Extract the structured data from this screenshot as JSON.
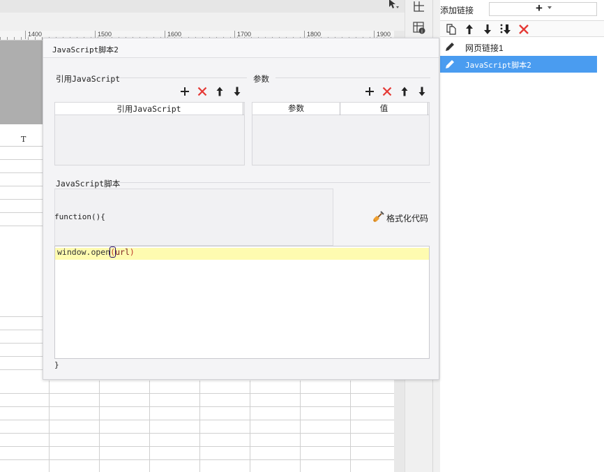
{
  "ruler": {
    "labels": [
      "1400",
      "1500",
      "1600",
      "1700",
      "1800",
      "1900"
    ]
  },
  "sheet": {
    "column_header": "T"
  },
  "link_panel": {
    "add_link_label": "添加链接",
    "add_link_button": "+",
    "toolbar": [
      {
        "name": "copy-icon"
      },
      {
        "name": "move-up-icon"
      },
      {
        "name": "move-down-icon"
      },
      {
        "name": "move-bottom-icon"
      },
      {
        "name": "delete-icon"
      }
    ],
    "items": [
      {
        "label": "网页链接1",
        "selected": false
      },
      {
        "label": "JavaScript脚本2",
        "selected": true
      }
    ]
  },
  "dialog": {
    "title": "JavaScript脚本2",
    "ref_section": {
      "label": "引用JavaScript",
      "table_header": "引用JavaScript"
    },
    "param_section": {
      "label": "参数",
      "columns": [
        "参数",
        "值"
      ]
    },
    "script_section": {
      "label": "JavaScript脚本",
      "function_open": "function(){",
      "code_fn": "window.open",
      "code_paren_open": "(",
      "code_arg": "url",
      "code_paren_close": ")",
      "function_close": "}",
      "format_button": "格式化代码"
    }
  },
  "colors": {
    "selection": "#4a9cf0",
    "delete_red": "#e53935",
    "current_line": "#fefbb0",
    "broom_orange": "#f0a030"
  }
}
